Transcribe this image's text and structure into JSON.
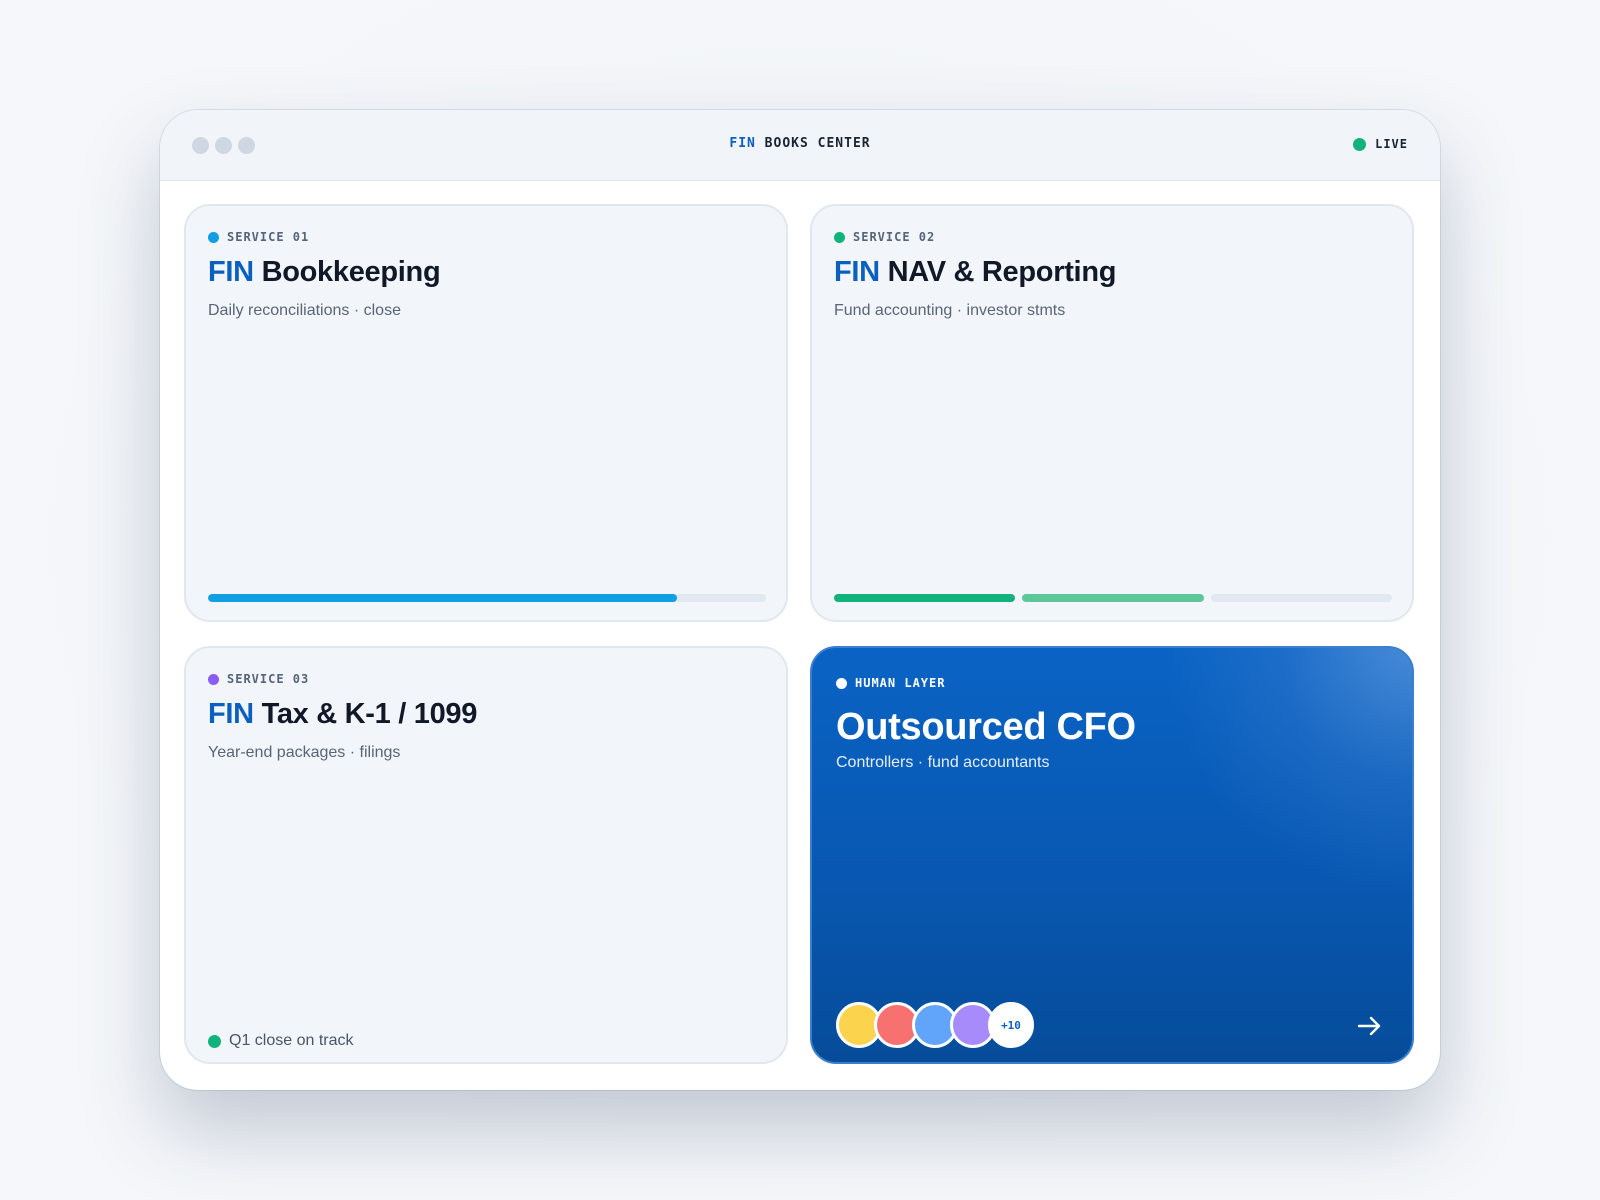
{
  "window": {
    "title_brand": "FIN",
    "title_rest": " BOOKS CENTER",
    "status_label": "LIVE",
    "status_color": "#12b37a"
  },
  "cards": [
    {
      "tag": "SERVICE 01",
      "tag_color": "#109fe2",
      "title_brand": "FIN",
      "title_rest": " Bookkeeping",
      "subtitle": "Daily reconciliations · close",
      "progress": 0.84
    },
    {
      "tag": "SERVICE 02",
      "tag_color": "#12b37a",
      "title_brand": "FIN",
      "title_rest": " NAV & Reporting",
      "subtitle": "Fund accounting · investor stmts",
      "steps_total": 3,
      "steps_complete": 2
    },
    {
      "tag": "SERVICE 03",
      "tag_color": "#8b5cf6",
      "title_brand": "FIN",
      "title_rest": " Tax & K-1 / 1099",
      "subtitle": "Year-end packages · filings",
      "status": "Q1 close on track"
    },
    {
      "tag": "HUMAN LAYER",
      "title": "Outsourced CFO",
      "subtitle": "Controllers · fund accountants",
      "avatar_colors": [
        "#fcd34d",
        "#f87171",
        "#60a5fa",
        "#a78bfa"
      ],
      "more_count": "+10",
      "action_icon": "arrow-right-icon"
    }
  ],
  "colors": {
    "brand": "#0b5fc0",
    "progress_blue": "#109fe2",
    "segment_green": "#12b37a",
    "segment_light_green": "#5ec79a"
  }
}
